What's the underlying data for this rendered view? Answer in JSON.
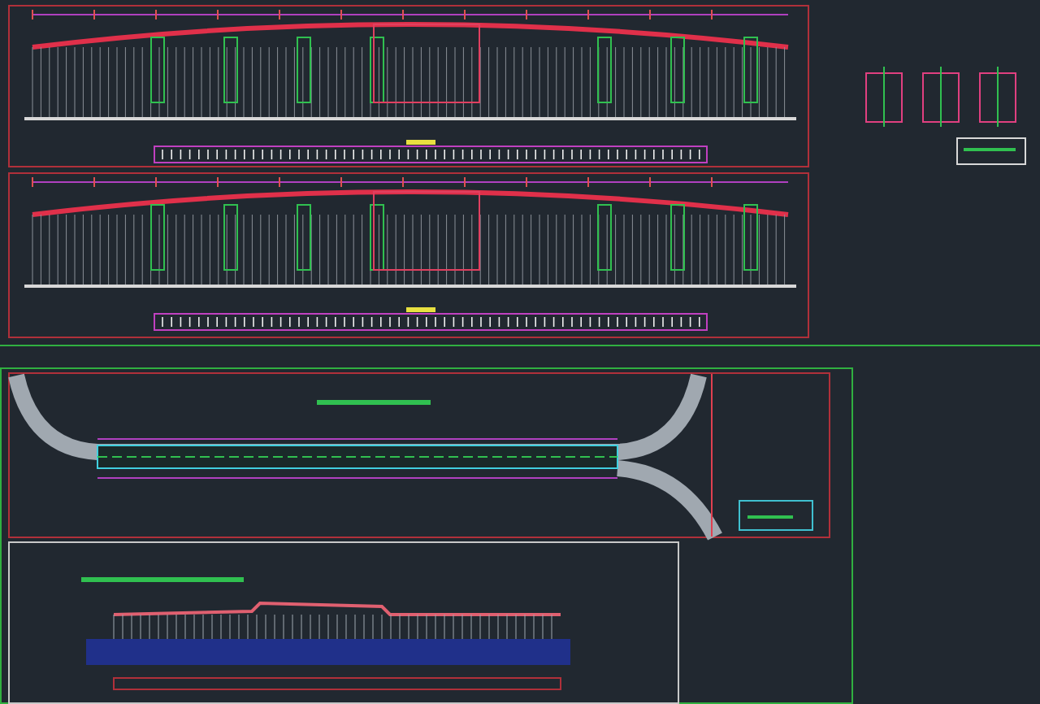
{
  "sheets": [
    {
      "kind": "profile"
    },
    {
      "kind": "details"
    },
    {
      "kind": "profile"
    },
    {
      "kind": "plan"
    },
    {
      "kind": "longitudinal"
    }
  ]
}
